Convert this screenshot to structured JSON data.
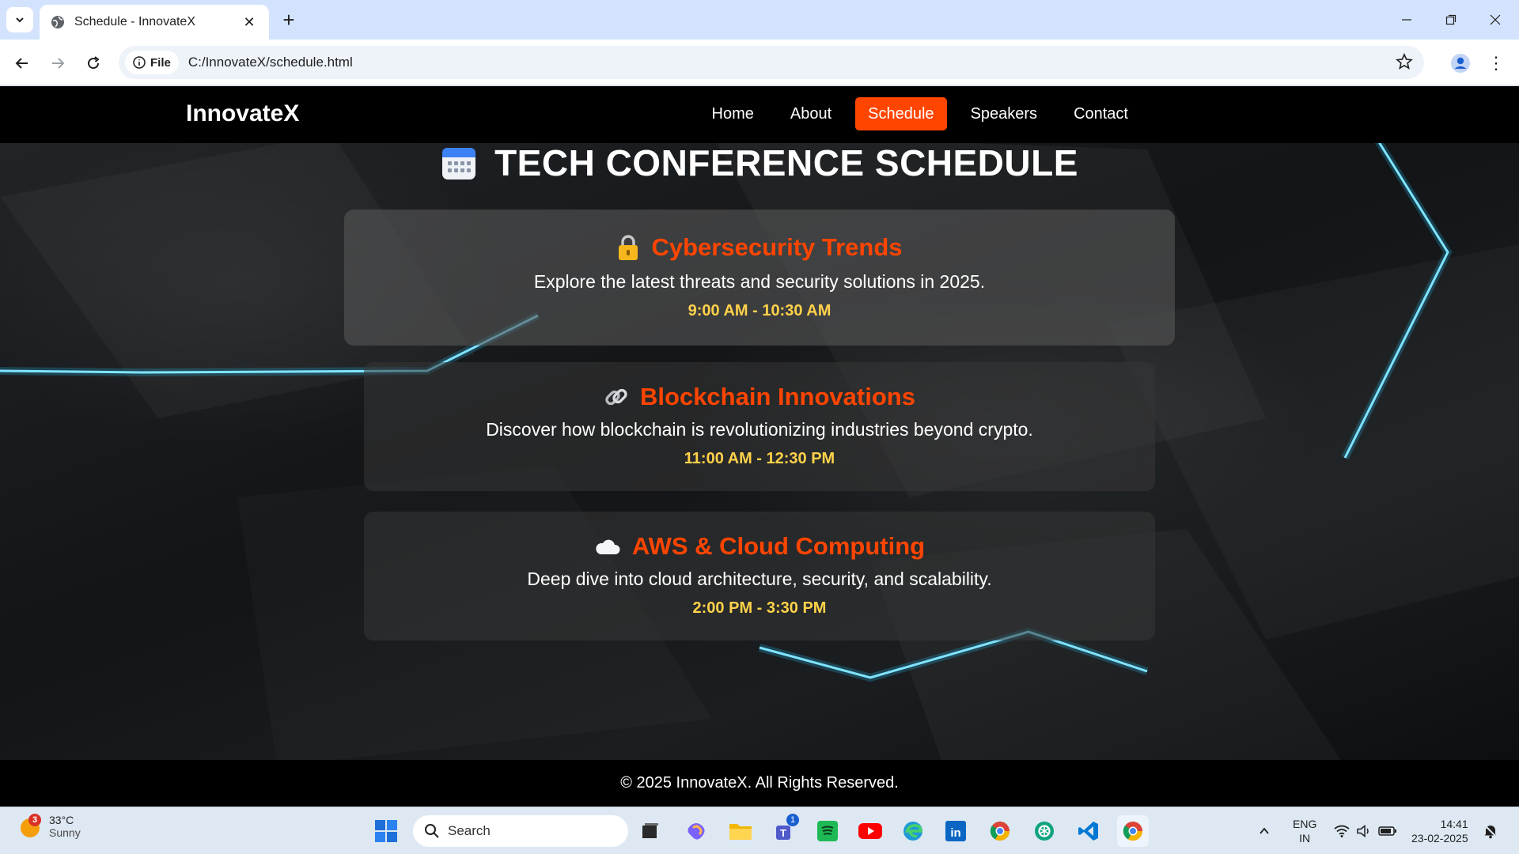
{
  "browser": {
    "tab_title": "Schedule - InnovateX",
    "file_chip": "File",
    "url": "C:/InnovateX/schedule.html"
  },
  "site": {
    "brand": "InnovateX",
    "nav": [
      "Home",
      "About",
      "Schedule",
      "Speakers",
      "Contact"
    ],
    "active_nav": "Schedule",
    "accent_color": "#ff4500",
    "time_color": "#ffd24a"
  },
  "page": {
    "title": "TECH CONFERENCE SCHEDULE",
    "title_icon": "calendar-icon"
  },
  "sessions": [
    {
      "icon": "lock-icon",
      "title": "Cybersecurity Trends",
      "description": "Explore the latest threats and security solutions in 2025.",
      "time": "9:00 AM - 10:30 AM"
    },
    {
      "icon": "link-icon",
      "title": "Blockchain Innovations",
      "description": "Discover how blockchain is revolutionizing industries beyond crypto.",
      "time": "11:00 AM - 12:30 PM"
    },
    {
      "icon": "cloud-icon",
      "title": "AWS & Cloud Computing",
      "description": "Deep dive into cloud architecture, security, and scalability.",
      "time": "2:00 PM - 3:30 PM"
    }
  ],
  "footer": {
    "text": "© 2025 InnovateX. All Rights Reserved."
  },
  "taskbar": {
    "weather_badge": "3",
    "temperature": "33°C",
    "condition": "Sunny",
    "search_label": "Search",
    "teams_badge": "1",
    "lang_line1": "ENG",
    "lang_line2": "IN",
    "time": "14:41",
    "date": "23-02-2025"
  }
}
